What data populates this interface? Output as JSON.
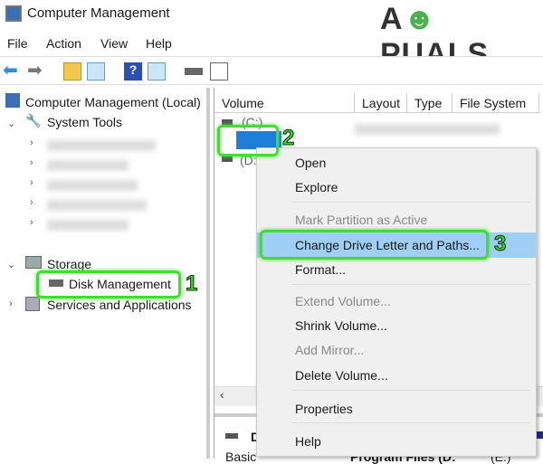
{
  "window": {
    "title": "Computer Management",
    "logo": "APPUALS"
  },
  "menu": [
    "File",
    "Action",
    "View",
    "Help"
  ],
  "toolbar": [
    "back-icon",
    "forward-icon",
    "up-folder-icon",
    "show-hide-tree-icon",
    "help-icon",
    "action-pane-icon",
    "connect-icon",
    "properties-icon"
  ],
  "tree": {
    "root": "Computer Management (Local)",
    "system_tools": "System Tools",
    "storage": "Storage",
    "disk_management": "Disk Management",
    "services": "Services and Applications"
  },
  "columns": [
    "Volume",
    "Layout",
    "Type",
    "File System"
  ],
  "volumes": [
    "(C:)",
    "(D:"
  ],
  "context_menu": [
    {
      "label": "Open",
      "enabled": true
    },
    {
      "label": "Explore",
      "enabled": true
    },
    {
      "label": "Mark Partition as Active",
      "enabled": false
    },
    {
      "label": "Change Drive Letter and Paths...",
      "enabled": true,
      "highlighted": true
    },
    {
      "label": "Format...",
      "enabled": true
    },
    {
      "label": "Extend Volume...",
      "enabled": false
    },
    {
      "label": "Shrink Volume...",
      "enabled": true
    },
    {
      "label": "Add Mirror...",
      "enabled": false
    },
    {
      "label": "Delete Volume...",
      "enabled": true
    },
    {
      "label": "Properties",
      "enabled": true
    },
    {
      "label": "Help",
      "enabled": true
    }
  ],
  "bottom": {
    "disk": "D",
    "basic": "Basic",
    "program_files": "Program Files (D:",
    "e": "(E:)"
  },
  "annotations": [
    "1",
    "2",
    "3"
  ],
  "colors": {
    "annotation": "#3de02a",
    "highlight": "#9fcff5"
  }
}
